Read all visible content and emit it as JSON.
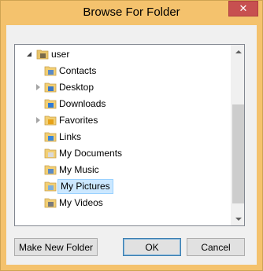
{
  "window": {
    "title": "Browse For Folder",
    "close_symbol": "✕"
  },
  "tree": {
    "items": [
      {
        "label": "user",
        "icon": "user-folder-icon",
        "expander": "expanded",
        "selected": false
      },
      {
        "label": "Contacts",
        "icon": "contacts-folder-icon",
        "expander": "none",
        "selected": false
      },
      {
        "label": "Desktop",
        "icon": "desktop-folder-icon",
        "expander": "collapsed",
        "selected": false
      },
      {
        "label": "Downloads",
        "icon": "downloads-folder-icon",
        "expander": "none",
        "selected": false
      },
      {
        "label": "Favorites",
        "icon": "favorites-folder-icon",
        "expander": "collapsed",
        "selected": false
      },
      {
        "label": "Links",
        "icon": "links-folder-icon",
        "expander": "none",
        "selected": false
      },
      {
        "label": "My Documents",
        "icon": "documents-folder-icon",
        "expander": "none",
        "selected": false
      },
      {
        "label": "My Music",
        "icon": "music-folder-icon",
        "expander": "none",
        "selected": false
      },
      {
        "label": "My Pictures",
        "icon": "pictures-folder-icon",
        "expander": "none",
        "selected": true
      },
      {
        "label": "My Videos",
        "icon": "videos-folder-icon",
        "expander": "none",
        "selected": false
      }
    ]
  },
  "buttons": {
    "make_new_folder": "Make New Folder",
    "ok": "OK",
    "cancel": "Cancel"
  },
  "colors": {
    "frame": "#f4c26d",
    "close": "#c75050",
    "selection_bg": "#cce8ff",
    "selection_border": "#99d1ff"
  }
}
